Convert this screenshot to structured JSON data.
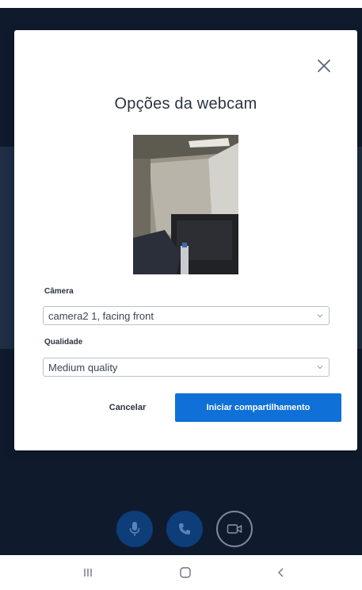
{
  "modal": {
    "title": "Opções da webcam",
    "camera_label": "Câmera",
    "camera_value": "camera2 1, facing front",
    "quality_label": "Qualidade",
    "quality_value": "Medium quality",
    "cancel_label": "Cancelar",
    "start_label": "Iniciar compartilhamento"
  },
  "icons": {
    "close": "close-icon",
    "mic": "microphone-icon",
    "phone": "phone-icon",
    "camera": "video-camera-icon",
    "recents": "recent-apps-icon",
    "home": "home-icon",
    "back": "back-icon"
  },
  "colors": {
    "primary_button": "#0f70d7",
    "app_background": "#0f1b2d",
    "control_active": "#0d3e7a"
  }
}
